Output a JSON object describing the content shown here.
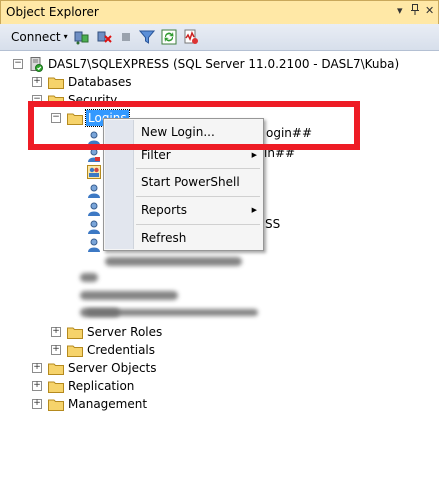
{
  "window": {
    "title": "Object Explorer",
    "pin": "▾",
    "pin2": "ᵖ",
    "close": "✕"
  },
  "toolbar": {
    "connect_label": "Connect",
    "connect_arrow": "▾"
  },
  "tree": {
    "server": "DASL7\\SQLEXPRESS (SQL Server 11.0.2100 - DASL7\\Kuba)",
    "databases": "Databases",
    "security": "Security",
    "logins": "Logins",
    "login_partial_1": "ogin##",
    "login_partial_2": "in##",
    "login_partial_3": "SS",
    "server_roles": "Server Roles",
    "credentials": "Credentials",
    "server_objects": "Server Objects",
    "replication": "Replication",
    "management": "Management"
  },
  "context_menu": {
    "new_login": "New Login...",
    "filter": "Filter",
    "start_powershell": "Start PowerShell",
    "reports": "Reports",
    "refresh": "Refresh",
    "submenu_arrow": "▶"
  },
  "colors": {
    "highlight": "#ee1c25",
    "selection": "#3399ff",
    "titlebar": "#ffe8a6"
  },
  "icons": [
    "connect-icon",
    "disconnect-icon",
    "stop-icon",
    "filter-icon",
    "refresh-icon",
    "activity-monitor-icon",
    "server-icon",
    "folder-icon",
    "login-user-icon"
  ]
}
